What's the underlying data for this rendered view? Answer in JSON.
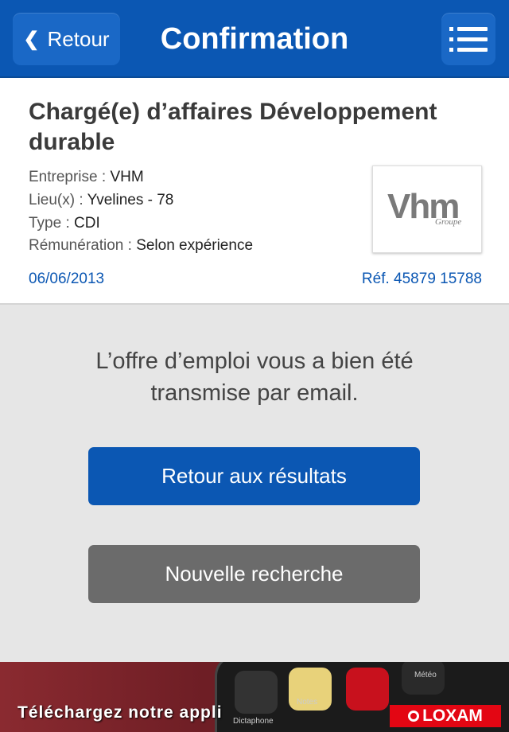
{
  "header": {
    "back_label": "Retour",
    "title": "Confirmation",
    "menu_icon": "hamburger-menu-icon"
  },
  "job": {
    "title": "Chargé(e) d’affaires Développement durable",
    "company_label": "Entreprise :",
    "company": "VHM",
    "location_label": "Lieu(x) :",
    "location": "Yvelines - 78",
    "type_label": "Type :",
    "type": "CDI",
    "salary_label": "Rémunération :",
    "salary": "Selon expérience",
    "date": "06/06/2013",
    "ref": "Réf. 45879 15788",
    "logo_main": "Vhm",
    "logo_sub": "Groupe"
  },
  "confirmation": {
    "line1": "L’offre d’emploi vous a bien été",
    "line2": "transmise par email."
  },
  "actions": {
    "back_to_results": "Retour aux résultats",
    "new_search": "Nouvelle recherche"
  },
  "ad": {
    "text": "Téléchargez notre appli",
    "brand": "LOXAM",
    "app_labels": [
      "Dictaphone",
      "Notes",
      "Météo"
    ]
  },
  "colors": {
    "primary": "#0b57b3",
    "secondary_button": "#6b6b6b",
    "background": "#e6e6e6",
    "brand_red": "#e30613"
  }
}
